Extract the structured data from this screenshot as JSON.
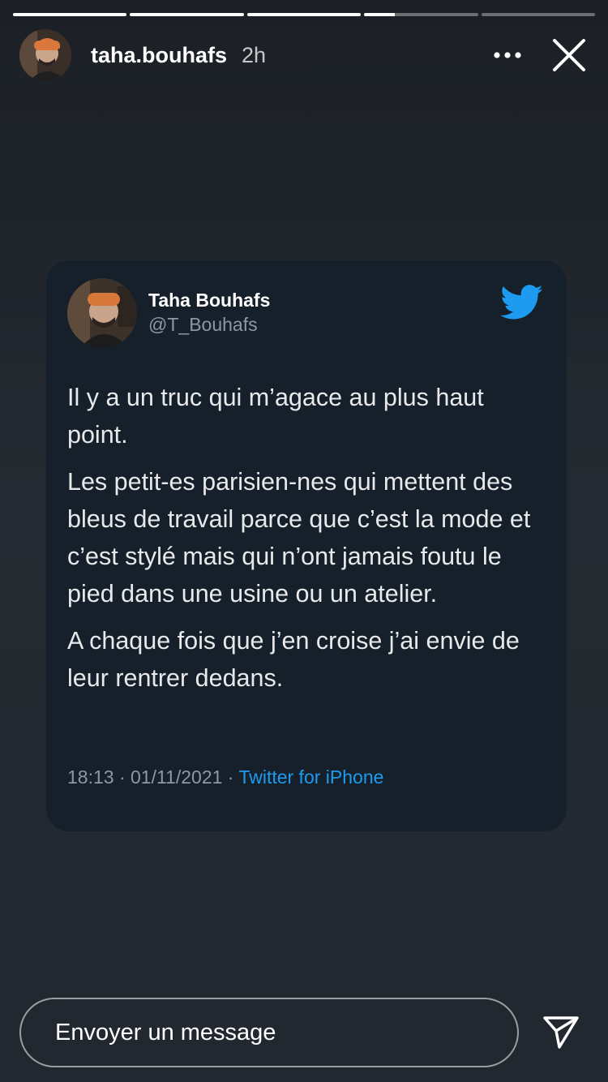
{
  "story": {
    "segments": [
      1,
      1,
      1,
      0.27,
      0
    ]
  },
  "header": {
    "username": "taha.bouhafs",
    "time_ago": "2h",
    "more_icon": "more-horizontal-icon",
    "close_icon": "close-icon"
  },
  "tweet": {
    "display_name": "Taha Bouhafs",
    "handle": "@T_Bouhafs",
    "paragraphs": [
      "Il y a un truc qui m’agace au plus haut point.",
      "Les petit-es parisien-nes qui mettent des bleus de travail parce que c’est la mode et c’est stylé mais qui n’ont jamais foutu le pied dans une usine ou un atelier.",
      "A chaque fois que j’en croise j’ai envie de leur rentrer dedans."
    ],
    "timestamp": "18:13 · 01/11/2021 · ",
    "source": "Twitter for iPhone",
    "brand_icon": "twitter-bird-icon",
    "brand_color": "#1d9bf0"
  },
  "footer": {
    "message_placeholder": "Envoyer un message",
    "send_icon": "send-icon"
  }
}
